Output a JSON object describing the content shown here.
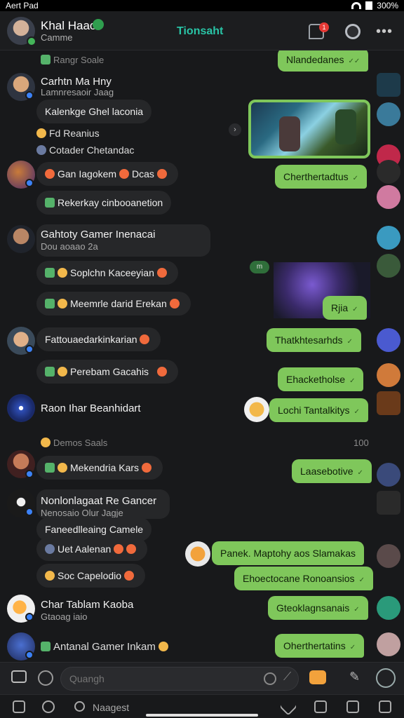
{
  "status": {
    "carrier": "Aert Pad",
    "battery": "300%"
  },
  "header": {
    "name": "Khal Haac",
    "subtitle": "Camme",
    "brand": "Tionsaht",
    "badge_count": "1"
  },
  "rows": [
    {
      "section": "Rangr Soale"
    },
    {
      "title": "Carhtn Ma Hny",
      "sub": "Lamnresaoir Jaag",
      "bubble": "Kalenkge Ghel laconia",
      "lines": [
        "Fd Reanius",
        "Cotader Chetandac"
      ]
    },
    {
      "lines": [
        "Gan Iagokem",
        "Dcas"
      ],
      "bubble": "Rekerkay cinbooanetion"
    },
    {
      "title": "Gahtoty Gamer Inenacai",
      "sub": "Dou aoaao 2a",
      "bubbles": [
        "Soplchn Kaceeyian",
        "Meemrle darid Erekan"
      ]
    },
    {
      "title": "Fattouaedarkinkarian",
      "bubble": "Perebam Gacahis"
    },
    {
      "title": "Raon Ihar Beanhidart"
    },
    {
      "section": "Demos Saals",
      "time": "100"
    },
    {
      "bubble": "Mekendria Kars"
    },
    {
      "title": "Nonlonlagaat Re Gancer",
      "sub": "Nenosaio Olur Jagje",
      "bubble": "Faneedlleaing Camele",
      "lines": [
        "Uet Aalenan",
        "Soc Capelodio"
      ]
    },
    {
      "title": "Char Tablam Kaoba",
      "sub": "Gtaoag iaio"
    },
    {
      "title": "Antanal Gamer Inkam"
    }
  ],
  "outgoing": [
    "Nlandedanes",
    "Cherthertadtus",
    "Rjia",
    "Thatkhtesarhds",
    "Ehacketholse",
    "Lochi Tantalkitys",
    "Laasebotive",
    "Panek. Maptohy aos Slamakas",
    "Ehoectocane Ronoansios",
    "Gteoklagnsanais",
    "Oherthertatins"
  ],
  "composer": {
    "placeholder": "Quangh"
  },
  "bottombar": {
    "search": "Naagest"
  }
}
